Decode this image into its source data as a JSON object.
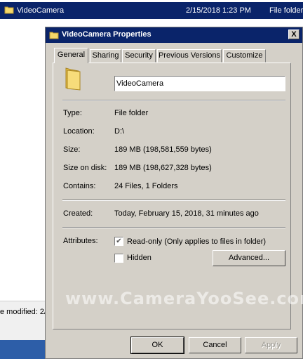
{
  "explorer": {
    "row": {
      "name": "VideoCamera",
      "date": "2/15/2018 1:23 PM",
      "type": "File folder"
    },
    "partial_label": "e modified: 2/",
    "folder_icon": "folder-icon"
  },
  "dialog": {
    "title": "VideoCamera Properties",
    "close_label": "X",
    "tabs": [
      "General",
      "Sharing",
      "Security",
      "Previous Versions",
      "Customize"
    ],
    "name_value": "VideoCamera",
    "properties": {
      "type": {
        "label": "Type:",
        "value": "File folder"
      },
      "location": {
        "label": "Location:",
        "value": "D:\\"
      },
      "size": {
        "label": "Size:",
        "value": "189 MB (198,581,559 bytes)"
      },
      "size_on_disk": {
        "label": "Size on disk:",
        "value": "189 MB (198,627,328 bytes)"
      },
      "contains": {
        "label": "Contains:",
        "value": "24 Files, 1 Folders"
      },
      "created": {
        "label": "Created:",
        "value": "Today, February 15, 2018, 31 minutes ago"
      }
    },
    "attributes": {
      "label": "Attributes:",
      "readonly": {
        "label": "Read-only (Only applies to files in folder)",
        "checked": true
      },
      "hidden": {
        "label": "Hidden",
        "checked": false
      },
      "advanced_label": "Advanced..."
    },
    "buttons": {
      "ok": "OK",
      "cancel": "Cancel",
      "apply": "Apply"
    },
    "watermark": "www.CameraYooSee.com"
  },
  "colors": {
    "titlebar": "#0a246a",
    "dialog_face": "#d4d0c8",
    "folder_yellow": "#f5d86a"
  }
}
